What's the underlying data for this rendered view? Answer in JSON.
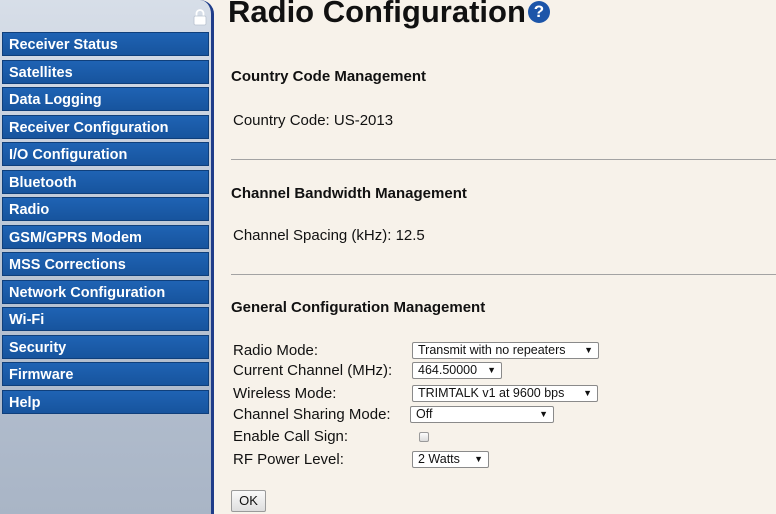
{
  "sidebar": {
    "lock_icon": "padlock-icon",
    "items": [
      {
        "label": "Receiver Status"
      },
      {
        "label": "Satellites"
      },
      {
        "label": "Data Logging"
      },
      {
        "label": "Receiver Configuration"
      },
      {
        "label": "I/O Configuration"
      },
      {
        "label": "Bluetooth"
      },
      {
        "label": "Radio"
      },
      {
        "label": "GSM/GPRS Modem"
      },
      {
        "label": "MSS Corrections"
      },
      {
        "label": "Network Configuration"
      },
      {
        "label": "Wi-Fi"
      },
      {
        "label": "Security"
      },
      {
        "label": "Firmware"
      },
      {
        "label": "Help"
      }
    ]
  },
  "page": {
    "title": "Radio Configuration",
    "help_icon": "?"
  },
  "country": {
    "heading": "Country Code Management",
    "text": "Country Code: US-2013"
  },
  "bandwidth": {
    "heading": "Channel Bandwidth Management",
    "text": "Channel Spacing (kHz): 12.5"
  },
  "general": {
    "heading": "General Configuration Management",
    "radio_mode": {
      "label": "Radio Mode:",
      "value": "Transmit with no repeaters"
    },
    "current_channel": {
      "label": "Current Channel (MHz):",
      "value": "464.50000"
    },
    "wireless_mode": {
      "label": "Wireless Mode:",
      "value": "TRIMTALK v1 at 9600 bps"
    },
    "channel_sharing": {
      "label": "Channel Sharing Mode:",
      "value": "Off"
    },
    "call_sign": {
      "label": "Enable Call Sign:",
      "checked": false
    },
    "rf_power": {
      "label": "RF Power Level:",
      "value": "2 Watts"
    }
  },
  "ok_label": "OK",
  "colors": {
    "menu_blue": "#1f63b4",
    "sidebar_border": "#1f3d8a",
    "page_background": "#f7f2ea"
  }
}
